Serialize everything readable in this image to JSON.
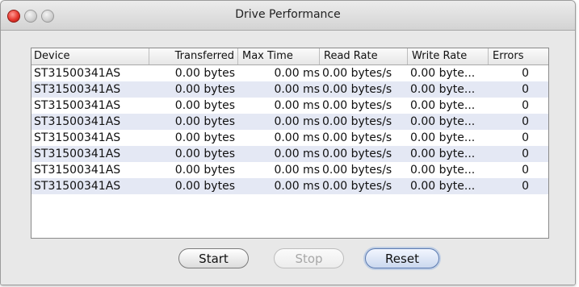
{
  "window": {
    "title": "Drive Performance"
  },
  "table": {
    "columns": [
      "Device",
      "Transferred",
      "Max Time",
      "Read Rate",
      "Write Rate",
      "Errors"
    ],
    "rows": [
      [
        "ST31500341AS",
        "0.00 bytes",
        "0.00 ms",
        "0.00 bytes/s",
        "0.00 byte...",
        "0"
      ],
      [
        "ST31500341AS",
        "0.00 bytes",
        "0.00 ms",
        "0.00 bytes/s",
        "0.00 byte...",
        "0"
      ],
      [
        "ST31500341AS",
        "0.00 bytes",
        "0.00 ms",
        "0.00 bytes/s",
        "0.00 byte...",
        "0"
      ],
      [
        "ST31500341AS",
        "0.00 bytes",
        "0.00 ms",
        "0.00 bytes/s",
        "0.00 byte...",
        "0"
      ],
      [
        "ST31500341AS",
        "0.00 bytes",
        "0.00 ms",
        "0.00 bytes/s",
        "0.00 byte...",
        "0"
      ],
      [
        "ST31500341AS",
        "0.00 bytes",
        "0.00 ms",
        "0.00 bytes/s",
        "0.00 byte...",
        "0"
      ],
      [
        "ST31500341AS",
        "0.00 bytes",
        "0.00 ms",
        "0.00 bytes/s",
        "0.00 byte...",
        "0"
      ],
      [
        "ST31500341AS",
        "0.00 bytes",
        "0.00 ms",
        "0.00 bytes/s",
        "0.00 byte...",
        "0"
      ]
    ]
  },
  "buttons": {
    "start": "Start",
    "stop": "Stop",
    "reset": "Reset"
  },
  "colors": {
    "close": "#e5362d",
    "rowAlt": "#e4e8f4",
    "defaultButton": "#5a7ab1"
  }
}
